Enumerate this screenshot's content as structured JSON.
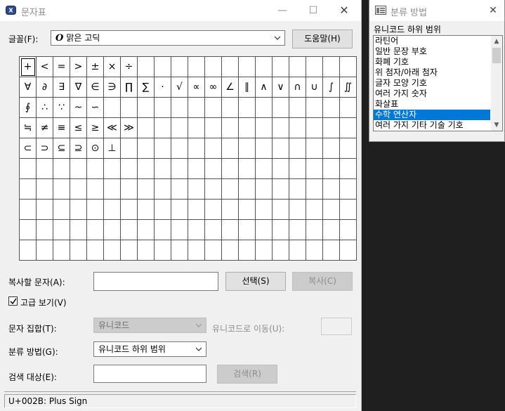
{
  "main_window": {
    "title": "문자표",
    "minimize_glyph": "—",
    "maximize_glyph": "☐",
    "close_glyph": "✕"
  },
  "font_row": {
    "label": "글꼴(F):",
    "font_glyph": "O",
    "font_value": "맑은 고딕",
    "help_button": "도움말(H)"
  },
  "char_grid": {
    "rows": [
      [
        "+",
        "<",
        "=",
        ">",
        "±",
        "×",
        "÷",
        "",
        "",
        "",
        "",
        "",
        "",
        "",
        "",
        "",
        "",
        "",
        "",
        ""
      ],
      [
        "∀",
        "∂",
        "∃",
        "∇",
        "∈",
        "∋",
        "∏",
        "∑",
        "·",
        "√",
        "∝",
        "∞",
        "∠",
        "∥",
        "∧",
        "∨",
        "∩",
        "∪",
        "∫",
        "∬"
      ],
      [
        "∮",
        "∴",
        "∵",
        "~",
        "∽",
        "",
        "",
        "",
        "",
        "",
        "",
        "",
        "",
        "",
        "",
        "",
        "",
        "",
        "",
        ""
      ],
      [
        "≒",
        "≠",
        "≡",
        "≤",
        "≥",
        "≪",
        "≫",
        "",
        "",
        "",
        "",
        "",
        "",
        "",
        "",
        "",
        "",
        "",
        "",
        ""
      ],
      [
        "⊂",
        "⊃",
        "⊆",
        "⊇",
        "⊙",
        "⊥",
        "",
        "",
        "",
        "",
        "",
        "",
        "",
        "",
        "",
        "",
        "",
        "",
        "",
        ""
      ],
      [
        "",
        "",
        "",
        "",
        "",
        "",
        "",
        "",
        "",
        "",
        "",
        "",
        "",
        "",
        "",
        "",
        "",
        "",
        "",
        ""
      ],
      [
        "",
        "",
        "",
        "",
        "",
        "",
        "",
        "",
        "",
        "",
        "",
        "",
        "",
        "",
        "",
        "",
        "",
        "",
        "",
        ""
      ],
      [
        "",
        "",
        "",
        "",
        "",
        "",
        "",
        "",
        "",
        "",
        "",
        "",
        "",
        "",
        "",
        "",
        "",
        "",
        "",
        ""
      ],
      [
        "",
        "",
        "",
        "",
        "",
        "",
        "",
        "",
        "",
        "",
        "",
        "",
        "",
        "",
        "",
        "",
        "",
        "",
        "",
        ""
      ],
      [
        "",
        "",
        "",
        "",
        "",
        "",
        "",
        "",
        "",
        "",
        "",
        "",
        "",
        "",
        "",
        "",
        "",
        "",
        "",
        ""
      ]
    ]
  },
  "copy_row": {
    "label": "복사할 문자(A):",
    "value": "",
    "select_button": "선택(S)",
    "copy_button": "복사(C)"
  },
  "advanced": {
    "label": "고급 보기(V)",
    "checked": true
  },
  "charset_row": {
    "label": "문자 집합(T):",
    "value": "유니코드",
    "goto_label": "유니코드로 이동(U):",
    "goto_value": ""
  },
  "group_row": {
    "label": "분류 방법(G):",
    "value": "유니코드 하위 범위"
  },
  "search_row": {
    "label": "검색 대상(E):",
    "value": "",
    "search_button": "검색(R)"
  },
  "status": {
    "text": "U+002B: Plus Sign"
  },
  "side_window": {
    "title": "분류 방법",
    "close_glyph": "✕",
    "list_label": "유니코드 하위 범위",
    "items": [
      {
        "label": "라틴어",
        "selected": false
      },
      {
        "label": "일반 문장 부호",
        "selected": false
      },
      {
        "label": "화폐 기호",
        "selected": false
      },
      {
        "label": "위 첨자/아래 첨자",
        "selected": false
      },
      {
        "label": "글자 모양 기호",
        "selected": false
      },
      {
        "label": "여러 가지 숫자",
        "selected": false
      },
      {
        "label": "화살표",
        "selected": false
      },
      {
        "label": "수학 연산자",
        "selected": true
      },
      {
        "label": "여러 가지 기타 기술 기호",
        "selected": false
      }
    ],
    "scroll_up_glyph": "▲",
    "scroll_down_glyph": "▼"
  },
  "colors": {
    "selection": "#0078d7",
    "window_bg": "#f0f0f0",
    "backdrop": "#1f1f1f"
  },
  "icons": {
    "app": "charmap-app-icon",
    "side": "category-window-icon"
  }
}
